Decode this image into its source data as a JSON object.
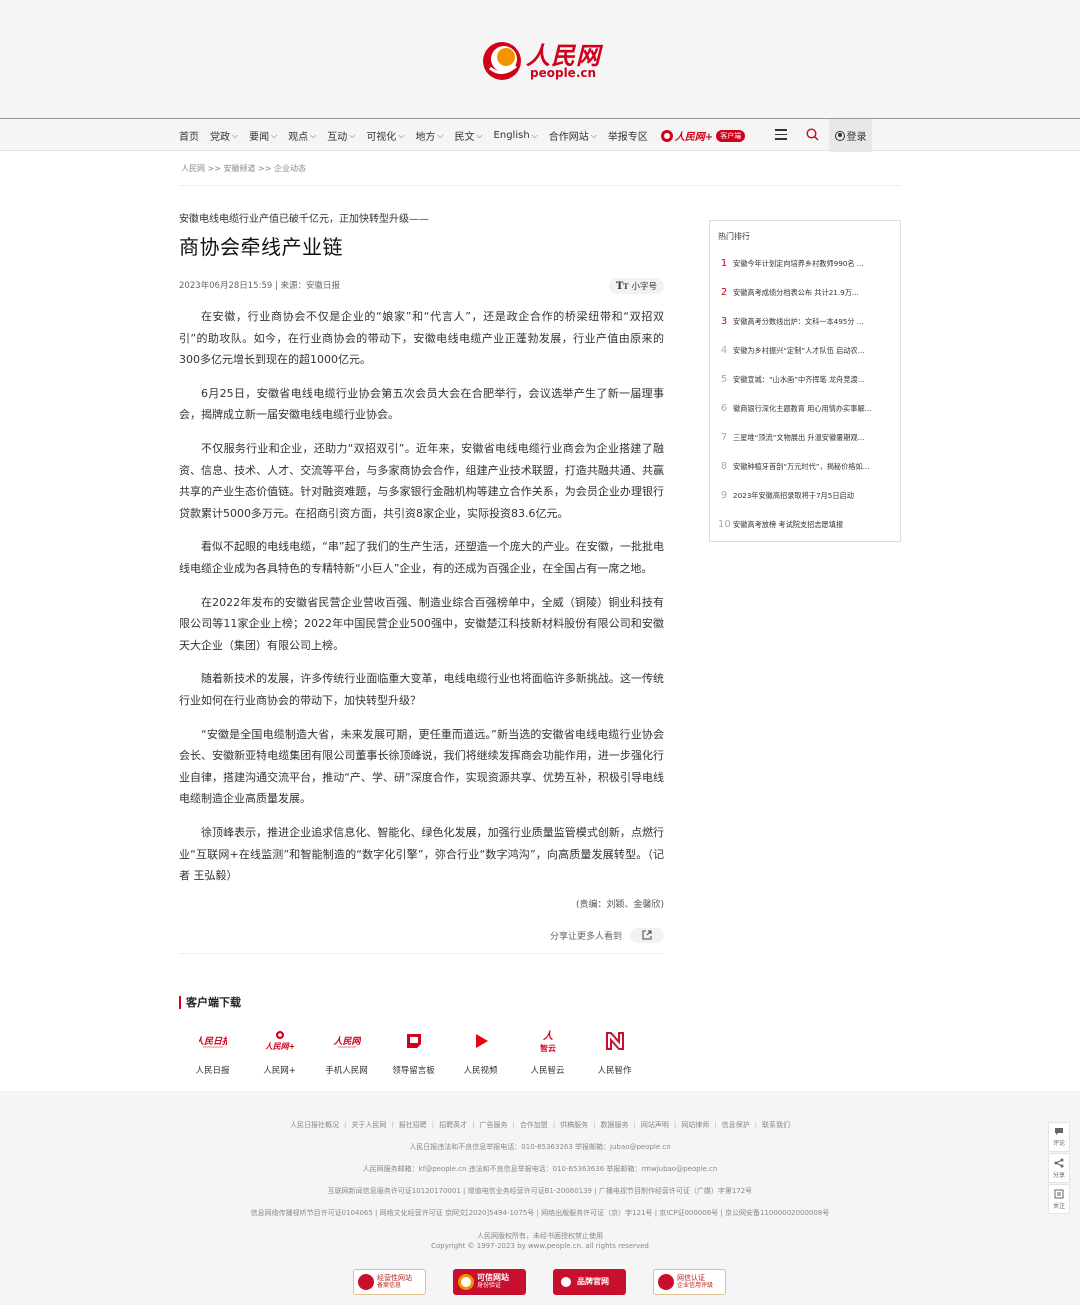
{
  "header": {
    "logo_cn": "人民网",
    "logo_en": "people.cn"
  },
  "nav": {
    "items": [
      {
        "label": "首页",
        "caret": false
      },
      {
        "label": "党政",
        "caret": true
      },
      {
        "label": "要闻",
        "caret": true
      },
      {
        "label": "观点",
        "caret": true
      },
      {
        "label": "互动",
        "caret": true
      },
      {
        "label": "可视化",
        "caret": true
      },
      {
        "label": "地方",
        "caret": true
      },
      {
        "label": "民文",
        "caret": true
      },
      {
        "label": "English",
        "caret": true
      },
      {
        "label": "合作网站",
        "caret": true
      },
      {
        "label": "举报专区",
        "caret": false
      }
    ],
    "app_name": "人民网+",
    "app_badge": "客户端",
    "login_label": "登录"
  },
  "breadcrumb": "人民网 >> 安徽频道 >> 企业动态",
  "article": {
    "subtitle": "安徽电线电缆行业产值已破千亿元，正加快转型升级——",
    "title": "商协会牵线产业链",
    "meta": "2023年06月28日15:59 | 来源：安徽日报",
    "font_toggle": "小字号",
    "paragraphs": [
      "在安徽，行业商协会不仅是企业的“娘家”和“代言人”，还是政企合作的桥梁纽带和“双招双引”的助攻队。如今，在行业商协会的带动下，安徽电线电缆产业正蓬勃发展，行业产值由原来的300多亿元增长到现在的超1000亿元。",
      "6月25日，安徽省电线电缆行业协会第五次会员大会在合肥举行，会议选举产生了新一届理事会，揭牌成立新一届安徽电线电缆行业协会。",
      "不仅服务行业和企业，还助力“双招双引”。近年来，安徽省电线电缆行业商会为企业搭建了融资、信息、技术、人才、交流等平台，与多家商协会合作，组建产业技术联盟，打造共融共通、共赢共享的产业生态价值链。针对融资难题，与多家银行金融机构等建立合作关系，为会员企业办理银行贷款累计5000多万元。在招商引资方面，共引资8家企业，实际投资83.6亿元。",
      "看似不起眼的电线电缆，“串”起了我们的生产生活，还塑造一个庞大的产业。在安徽，一批批电线电缆企业成为各具特色的专精特新“小巨人”企业，有的还成为百强企业，在全国占有一席之地。",
      "在2022年发布的安徽省民营企业营收百强、制造业综合百强榜单中，全威（铜陵）铜业科技有限公司等11家企业上榜；2022年中国民营企业500强中，安徽楚江科技新材料股份有限公司和安徽天大企业（集团）有限公司上榜。",
      "随着新技术的发展，许多传统行业面临重大变革，电线电缆行业也将面临许多新挑战。这一传统行业如何在行业商协会的带动下，加快转型升级？",
      "“安徽是全国电缆制造大省，未来发展可期，更任重而道远。”新当选的安徽省电线电缆行业协会会长、安徽新亚特电缆集团有限公司董事长徐顶峰说，我们将继续发挥商会功能作用，进一步强化行业自律，搭建沟通交流平台，推动“产、学、研”深度合作，实现资源共享、优势互补，积极引导电线电缆制造企业高质量发展。",
      "徐顶峰表示，推进企业追求信息化、智能化、绿色化发展，加强行业质量监管模式创新，点燃行业“互联网+在线监测”和智能制造的“数字化引擎”，弥合行业“数字鸿沟”，向高质量发展转型。（记者 王弘毅）"
    ],
    "editor": "(责编：刘颖、金馨欣)",
    "share_text": "分享让更多人看到"
  },
  "sidebar": {
    "title": "热门排行",
    "items": [
      {
        "rank": "1",
        "text": "安徽今年计划定向培养乡村教师990名 ..."
      },
      {
        "rank": "2",
        "text": "安徽高考成绩分档表公布 共计21.9万..."
      },
      {
        "rank": "3",
        "text": "安徽高考分数线出炉：文科一本495分 ..."
      },
      {
        "rank": "4",
        "text": "安徽为乡村振兴“定制”人才队伍 启动农..."
      },
      {
        "rank": "5",
        "text": "安徽宣城：“山水画”中齐挥笔 龙舟竞渡..."
      },
      {
        "rank": "6",
        "text": "徽商银行深化主题教育 用心用情办实事解..."
      },
      {
        "rank": "7",
        "text": "三星堆“顶流”文物展出 升温安徽暑期观..."
      },
      {
        "rank": "8",
        "text": "安徽种植牙首剖“万元时代”，揭秘价格如..."
      },
      {
        "rank": "9",
        "text": "2023年安徽高招录取将于7月5日启动"
      },
      {
        "rank": "10",
        "text": "安徽高考放榜 考试院支招志愿填报"
      }
    ]
  },
  "apps": {
    "title": "客户端下载",
    "items": [
      {
        "label": "人民日报",
        "icon": "people-daily-icon",
        "color": "#d0021b"
      },
      {
        "label": "人民网+",
        "icon": "people-plus-icon",
        "color": "#d0021b"
      },
      {
        "label": "手机人民网",
        "icon": "mobile-people-icon",
        "color": "#d0021b"
      },
      {
        "label": "领导留言板",
        "icon": "message-board-icon",
        "color": "#d0021b"
      },
      {
        "label": "人民视频",
        "icon": "video-play-icon",
        "color": "#e60012"
      },
      {
        "label": "人民智云",
        "icon": "zhiyun-icon",
        "color": "#d0021b"
      },
      {
        "label": "人民智作",
        "icon": "zhizuo-icon",
        "color": "#c8102e"
      }
    ]
  },
  "footer": {
    "links": [
      "人民日报社概况",
      "关于人民网",
      "报社招聘",
      "招聘英才",
      "广告服务",
      "合作加盟",
      "供稿服务",
      "数据服务",
      "网站声明",
      "网站律师",
      "信息保护",
      "联系我们"
    ],
    "line2": "人民日报违法和不良信息举报电话：010-65363263    举报邮箱：jubao@people.cn",
    "line3": "人民网服务邮箱：kf@people.cn    违法和不良信息举报电话：010-65363636    举报邮箱：rmwjubao@people.cn",
    "line4": "互联网新闻信息服务许可证10120170001 | 增值电信业务经营许可证B1-20060139 | 广播电视节目制作经营许可证（广媒）字第172号",
    "line5": "信息网络传播视听节目许可证0104065 | 网络文化经营许可证 京网文[2020]5494-1075号 | 网络出版服务许可证（京）字121号 | 京ICP证000006号 | 京公网安备11000002000008号",
    "line6": "人民网版权所有，未经书面授权禁止使用",
    "line7": "Copyright © 1997-2023 by www.people.cn. all rights reserved",
    "badges": [
      {
        "line1": "经营性网站",
        "line2": "备案信息",
        "style": "plain"
      },
      {
        "line1": "可信网站",
        "line2": "身份验证",
        "style": "red"
      },
      {
        "line1": "品牌官网",
        "line2": "",
        "style": "red"
      },
      {
        "line1": "网信认证",
        "line2": "企业信用评级",
        "style": "plain"
      }
    ]
  },
  "float_tools": {
    "comment": "评论",
    "share": "分享",
    "follow": "关注"
  },
  "colors": {
    "brand_red": "#d0021b",
    "header_bg": "#f5f5f5"
  }
}
